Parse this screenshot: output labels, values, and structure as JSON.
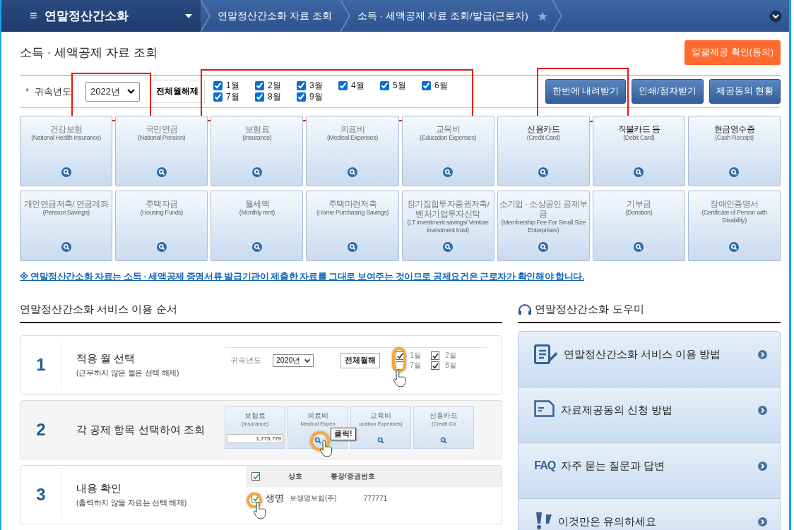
{
  "nav": {
    "menu_icon": "≡",
    "title": "연말정산간소화",
    "breadcrumbs": [
      "연말정산간소화 자료 조회",
      "소득 · 세액공제 자료 조회/발급(근로자)"
    ],
    "favorite": false
  },
  "page_title": "소득 · 세액공제 자료 조회",
  "consent_button": "일괄제공 확인(동의)",
  "filter": {
    "required_mark": "*",
    "year_label": "귀속년도",
    "year": "2022년",
    "year_highlighted": true,
    "clear_button": "전체월해제",
    "months_highlighted": true,
    "months": [
      {
        "label": "1월",
        "checked": true
      },
      {
        "label": "2월",
        "checked": true
      },
      {
        "label": "3월",
        "checked": true
      },
      {
        "label": "4월",
        "checked": true
      },
      {
        "label": "5월",
        "checked": true
      },
      {
        "label": "6월",
        "checked": true
      },
      {
        "label": "7월",
        "checked": true
      },
      {
        "label": "8월",
        "checked": true
      },
      {
        "label": "9월",
        "checked": true
      }
    ],
    "actions": [
      {
        "label": "한번에 내려받기",
        "highlighted": true
      },
      {
        "label": "인쇄/점자받기",
        "highlighted": false
      },
      {
        "label": "제공동의 현황",
        "highlighted": false
      }
    ]
  },
  "categories": [
    {
      "title": "건강보험",
      "sub": "(National Health Insurance)",
      "active": false
    },
    {
      "title": "국민연금",
      "sub": "(National Pension)",
      "active": false
    },
    {
      "title": "보험료",
      "sub": "(Insurance)",
      "active": false
    },
    {
      "title": "의료비",
      "sub": "(Medical Expenses)",
      "active": false
    },
    {
      "title": "교육비",
      "sub": "(Education Expenses)",
      "active": false
    },
    {
      "title": "신용카드",
      "sub": "(Credit Card)",
      "active": true
    },
    {
      "title": "직불카드 등",
      "sub": "(Debit Card)",
      "active": true
    },
    {
      "title": "현금영수증",
      "sub": "(Cash Receipt)",
      "active": true
    },
    {
      "title": "개인연금저축/ 연금계좌",
      "sub": "(Pension Savings)",
      "active": false
    },
    {
      "title": "주택자금",
      "sub": "(Housing Funds)",
      "active": false
    },
    {
      "title": "월세액",
      "sub": "(Monthly rent)",
      "active": false
    },
    {
      "title": "주택마련저축",
      "sub": "(Home Purchasing Savings)",
      "active": false
    },
    {
      "title": "장기집합투자증권저축/ 벤처기업투자신탁",
      "sub": "(LT investment savings/ Venture investment trust)",
      "active": false
    },
    {
      "title": "소기업 · 소상공인 공제부금",
      "sub": "(Membership Fee For Small Size Enterprises)",
      "active": false
    },
    {
      "title": "기부금",
      "sub": "(Donation)",
      "active": false
    },
    {
      "title": "장애인증명서",
      "sub": "(Certificate of Person with Disability)",
      "active": false
    }
  ],
  "notice": "※ 연말정산간소화 자료는 소득 · 세액공제 증명서류 발급기관이 제출한 자료를 그대로 보여주는 것이므로 공제요건은 근로자가 확인해야 합니다.",
  "steps_heading": "연말정산간소화 서비스 이용 순서",
  "steps": [
    {
      "kind": "months",
      "number": "1",
      "title": "적용 월 선택",
      "sub": "(근무하지 않은 월은 선택 해제)",
      "year_label": "귀속년도",
      "year": "2020년",
      "button": "전체월해",
      "months": [
        {
          "label": "1월",
          "checked": true
        },
        {
          "label": "2월",
          "checked": true
        },
        {
          "label": "7월",
          "checked": false
        },
        {
          "label": "8월",
          "checked": true
        }
      ]
    },
    {
      "kind": "tiles",
      "number": "2",
      "title": "각 공제 항목 선택하여 조회",
      "tiles": [
        {
          "title": "보험료",
          "sub": "(Insurance)",
          "value": "1,775,779"
        },
        {
          "title": "의료비",
          "sub": "Medical Expen"
        },
        {
          "title": "교육비",
          "sub": "ucation Expenses)"
        },
        {
          "title": "신용카드",
          "sub": "(Credit Ca"
        }
      ],
      "callout": "클릭!"
    },
    {
      "kind": "table",
      "number": "3",
      "title": "내용 확인",
      "sub": "(출력하지 않을 자료는 선택 해제)",
      "columns": [
        "상호",
        "통장/증권번호"
      ],
      "header_checked": true,
      "row": {
        "checked": true,
        "cells": [
          "생명",
          "보생명보험(주)",
          "777771"
        ]
      }
    }
  ],
  "helper_heading": "연말정산간소화 도우미",
  "helpers": [
    {
      "kind": "document",
      "label": "연말정산간소화 서비스 이용 방법"
    },
    {
      "kind": "form",
      "label": "자료제공동의 신청 방법"
    },
    {
      "kind": "faq",
      "badge": "FAQ",
      "label": "자주 묻는 질문과 답변"
    },
    {
      "kind": "caution",
      "label": "이것만은 유의하세요"
    }
  ]
}
